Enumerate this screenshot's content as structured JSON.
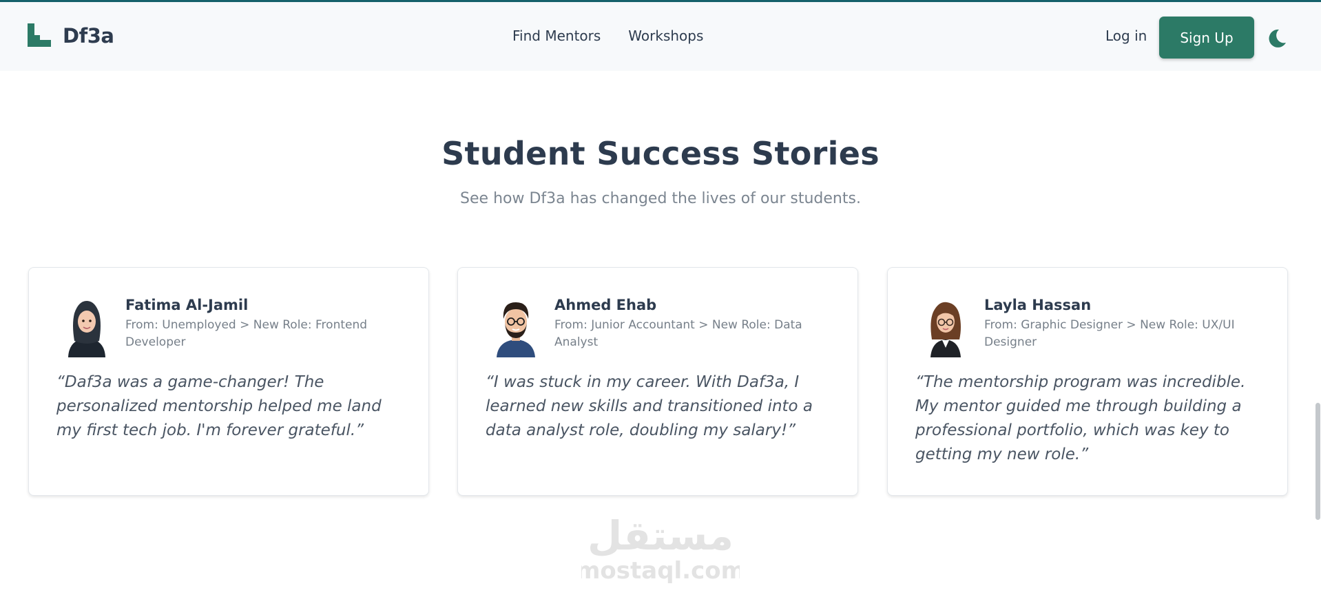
{
  "header": {
    "brand": "Df3a",
    "nav": [
      "Find Mentors",
      "Workshops"
    ],
    "login_label": "Log in",
    "signup_label": "Sign Up"
  },
  "section": {
    "title": "Student Success Stories",
    "subtitle": "See how Df3a has changed the lives of our students."
  },
  "testimonials": [
    {
      "name": "Fatima Al-Jamil",
      "role": "From: Unemployed > New Role: Frontend Developer",
      "quote": "“Daf3a was a game-changer! The personalized mentorship helped me land my first tech job. I'm forever grateful.”",
      "avatar_icon": "hijab-woman-avatar-icon"
    },
    {
      "name": "Ahmed Ehab",
      "role": "From: Junior Accountant > New Role: Data Analyst",
      "quote": "“I was stuck in my career. With Daf3a, I learned new skills and transitioned into a data analyst role, doubling my salary!”",
      "avatar_icon": "bearded-man-avatar-icon"
    },
    {
      "name": "Layla Hassan",
      "role": "From: Graphic Designer > New Role: UX/UI Designer",
      "quote": "“The mentorship program was incredible. My mentor guided me through building a professional portfolio, which was key to getting my new role.”",
      "avatar_icon": "woman-glasses-avatar-icon"
    }
  ],
  "watermark": {
    "arabic": "مستقل",
    "latin": "mostaql.com"
  },
  "colors": {
    "primary": "#2c7a66",
    "topline": "#16616b",
    "heading": "#2d3b4e",
    "muted": "#7b8590",
    "header_bg": "#f7f9fb"
  },
  "icons": {
    "logo": "staircase-logo-icon",
    "theme_toggle": "moon-icon"
  }
}
